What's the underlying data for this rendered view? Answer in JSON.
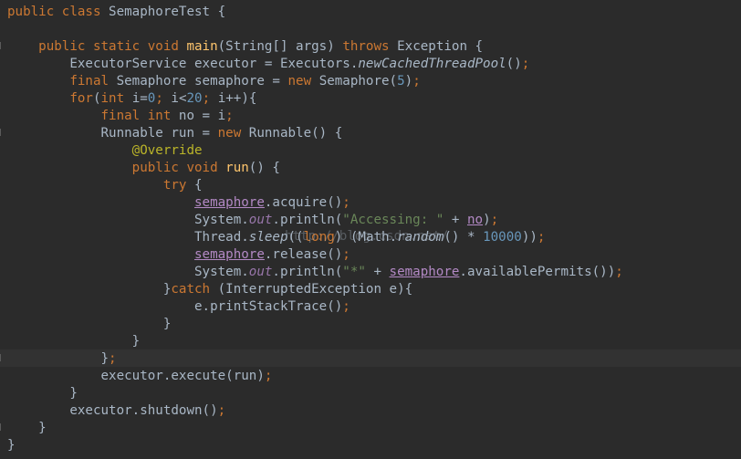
{
  "code": {
    "class_name": "SemaphoreTest",
    "watermark": "http://blog.csdn.net/"
  },
  "colors": {
    "background": "#2b2b2b",
    "keyword": "#cc7832",
    "number": "#6897bb",
    "string": "#6a8759",
    "method_decl": "#ffc66d",
    "annotation": "#bbb529",
    "field": "#9876aa",
    "default_text": "#a9b7c6"
  }
}
